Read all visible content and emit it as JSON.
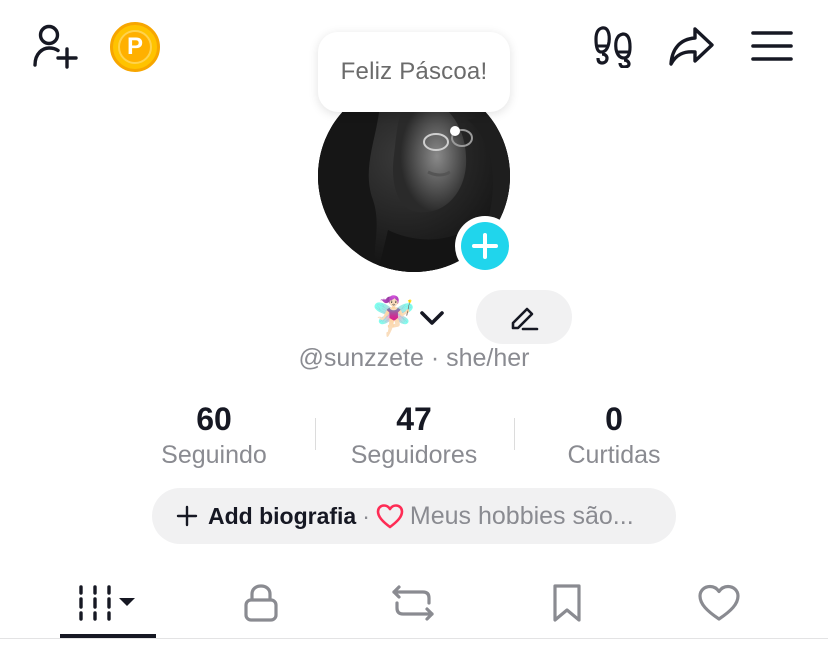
{
  "header": {
    "add_friend_icon": "person-add-icon",
    "coin_icon": "coin-p-icon",
    "coin_letter": "P",
    "footprints_icon": "footprints-icon",
    "share_icon": "share-arrow-icon",
    "menu_icon": "hamburger-menu-icon"
  },
  "bubble": {
    "text": "Feliz Páscoa!"
  },
  "avatar": {
    "add_icon": "plus-icon",
    "accent": "#20D5EC"
  },
  "profile": {
    "name_emoji": "🧚🏻‍♀️",
    "handle": "@sunzzete · she/her"
  },
  "stats": [
    {
      "value": "60",
      "label": "Seguindo"
    },
    {
      "value": "47",
      "label": "Seguidores"
    },
    {
      "value": "0",
      "label": "Curtidas"
    }
  ],
  "bio": {
    "add_label": "Add biografia",
    "separator": "·",
    "hobbies": "Meus hobbies são..."
  },
  "tabs": [
    {
      "name": "videos",
      "icon": "grid-bars-icon",
      "active": true
    },
    {
      "name": "private",
      "icon": "lock-icon",
      "active": false
    },
    {
      "name": "reposts",
      "icon": "repost-icon",
      "active": false
    },
    {
      "name": "saved",
      "icon": "bookmark-icon",
      "active": false
    },
    {
      "name": "liked",
      "icon": "heart-outline-icon",
      "active": false
    }
  ],
  "colors": {
    "text": "#161823",
    "muted": "#8a8b91",
    "pill": "#F1F1F2",
    "coin": "#FFC300",
    "heart": "#FE2C55"
  }
}
